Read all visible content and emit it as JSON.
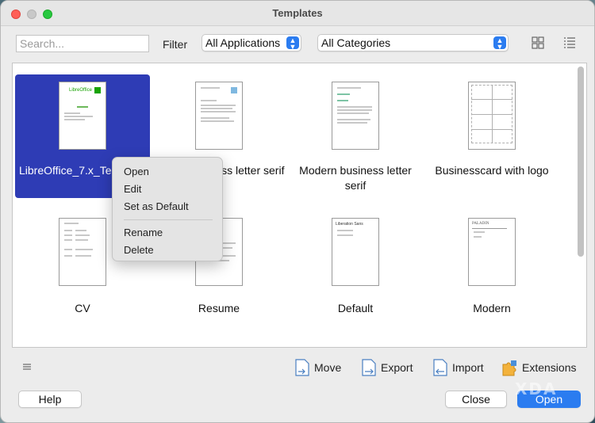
{
  "window": {
    "title": "Templates"
  },
  "toolbar": {
    "search_placeholder": "Search...",
    "filter_label": "Filter",
    "application_filter": "All Applications",
    "category_filter": "All Categories",
    "view_icons": [
      "grid-view-icon",
      "list-view-icon"
    ]
  },
  "templates": [
    {
      "label": "LibreOffice_7.x_Te",
      "selected": true
    },
    {
      "label": "ness letter serif",
      "selected": false
    },
    {
      "label": "Modern business letter serif",
      "selected": false
    },
    {
      "label": "Businesscard with logo",
      "selected": false
    },
    {
      "label": "CV",
      "selected": false
    },
    {
      "label": "Resume",
      "selected": false
    },
    {
      "label": "Default",
      "selected": false
    },
    {
      "label": "Modern",
      "selected": false
    }
  ],
  "thumb_text": {
    "libreoffice_logo": "LibreOffice",
    "default_heading": "Liberation Sans",
    "modern_heading": "PALADIN"
  },
  "context_menu": {
    "items": [
      "Open",
      "Edit",
      "Set as Default"
    ],
    "items2": [
      "Rename",
      "Delete"
    ]
  },
  "bottom_bar": {
    "move": "Move",
    "export": "Export",
    "import": "Import",
    "extensions": "Extensions"
  },
  "buttons": {
    "help": "Help",
    "close": "Close",
    "open": "Open"
  },
  "watermark": "XDA",
  "colors": {
    "accent": "#2b7cf0",
    "selection": "#2e3cb5"
  }
}
